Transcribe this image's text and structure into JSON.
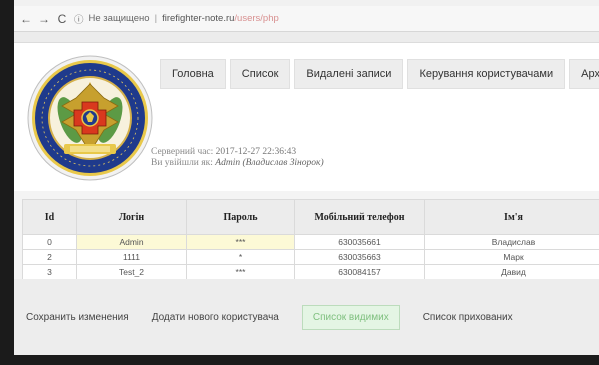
{
  "browser": {
    "nav": [
      "←",
      "→",
      "C"
    ],
    "not_secure": "Не защищено",
    "url_host": "firefighter-note.ru",
    "url_path": "/users/php"
  },
  "menu": [
    "Головна",
    "Список",
    "Видалені записи",
    "Керування користувачами",
    "Архів з"
  ],
  "info": {
    "time_label": "Серверний час:",
    "time_value": "2017-12-27 22:36:43",
    "user_label": "Ви увійшли як:",
    "user_value": "Admin (Владислав Зінорок)"
  },
  "table": {
    "headers": [
      "Id",
      "Логін",
      "Пароль",
      "Мобільний телефон",
      "Ім'я"
    ],
    "rows": [
      [
        "0",
        "Admin",
        "***",
        "630035661",
        "Владислав"
      ],
      [
        "2",
        "1111",
        "*",
        "630035663",
        "Марк"
      ],
      [
        "3",
        "Test_2",
        "***",
        "630084157",
        "Давид"
      ]
    ]
  },
  "actions": {
    "save": "Сохранить изменения",
    "add_user": "Додати нового користувача",
    "list_visible": "Список видимих",
    "list_hidden": "Список прихованих"
  },
  "colors": {
    "active_bg": "#e4f5e4",
    "active_text": "#7fc07f",
    "highlight_cell": "#fcf9d6"
  }
}
